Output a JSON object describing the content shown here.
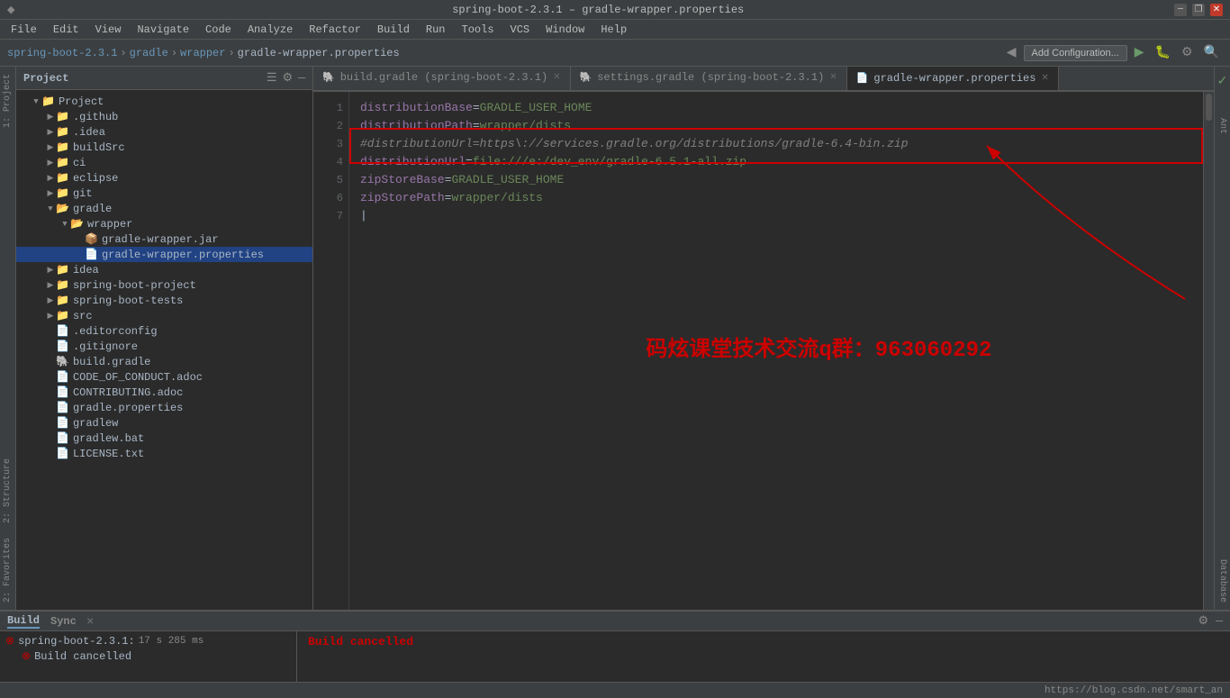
{
  "titleBar": {
    "title": "spring-boot-2.3.1 – gradle-wrapper.properties",
    "logo": "◆",
    "minimize": "—",
    "restore": "❐",
    "close": "✕"
  },
  "menuBar": {
    "items": [
      "File",
      "Edit",
      "View",
      "Navigate",
      "Code",
      "Analyze",
      "Refactor",
      "Build",
      "Run",
      "Tools",
      "VCS",
      "Window",
      "Help"
    ]
  },
  "toolbar": {
    "breadcrumbs": [
      "spring-boot-2.3.1",
      "gradle",
      "wrapper",
      "gradle-wrapper.properties"
    ],
    "addConfigLabel": "Add Configuration...",
    "icons": [
      "▶",
      "▶▶",
      "⏹",
      "🔨",
      "⚙"
    ]
  },
  "projectPanel": {
    "title": "Project",
    "items": [
      {
        "label": "Project",
        "type": "root",
        "depth": 0,
        "open": true
      },
      {
        "label": ".github",
        "type": "folder",
        "depth": 1,
        "open": false
      },
      {
        "label": ".idea",
        "type": "folder",
        "depth": 1,
        "open": false
      },
      {
        "label": "buildSrc",
        "type": "folder",
        "depth": 1,
        "open": false
      },
      {
        "label": "ci",
        "type": "folder",
        "depth": 1,
        "open": false
      },
      {
        "label": "eclipse",
        "type": "folder",
        "depth": 1,
        "open": false
      },
      {
        "label": "git",
        "type": "folder",
        "depth": 1,
        "open": false
      },
      {
        "label": "gradle",
        "type": "folder",
        "depth": 1,
        "open": true
      },
      {
        "label": "wrapper",
        "type": "folder",
        "depth": 2,
        "open": true
      },
      {
        "label": "gradle-wrapper.jar",
        "type": "jar",
        "depth": 3,
        "open": false
      },
      {
        "label": "gradle-wrapper.properties",
        "type": "properties",
        "depth": 3,
        "open": false,
        "selected": true
      },
      {
        "label": "idea",
        "type": "folder",
        "depth": 1,
        "open": false
      },
      {
        "label": "spring-boot-project",
        "type": "folder",
        "depth": 1,
        "open": false
      },
      {
        "label": "spring-boot-tests",
        "type": "folder",
        "depth": 1,
        "open": false
      },
      {
        "label": "src",
        "type": "folder",
        "depth": 1,
        "open": false
      },
      {
        "label": ".editorconfig",
        "type": "file",
        "depth": 1,
        "open": false
      },
      {
        "label": ".gitignore",
        "type": "file",
        "depth": 1,
        "open": false
      },
      {
        "label": "build.gradle",
        "type": "gradle",
        "depth": 1,
        "open": false
      },
      {
        "label": "CODE_OF_CONDUCT.adoc",
        "type": "file",
        "depth": 1,
        "open": false
      },
      {
        "label": "CONTRIBUTING.adoc",
        "type": "file",
        "depth": 1,
        "open": false
      },
      {
        "label": "gradle.properties",
        "type": "properties",
        "depth": 1,
        "open": false
      },
      {
        "label": "gradlew",
        "type": "file",
        "depth": 1,
        "open": false
      },
      {
        "label": "gradlew.bat",
        "type": "file",
        "depth": 1,
        "open": false
      },
      {
        "label": "LICENSE.txt",
        "type": "txt",
        "depth": 1,
        "open": false
      }
    ]
  },
  "tabs": [
    {
      "label": "build.gradle (spring-boot-2.3.1)",
      "active": false,
      "modified": false
    },
    {
      "label": "settings.gradle (spring-boot-2.3.1)",
      "active": false,
      "modified": false
    },
    {
      "label": "gradle-wrapper.properties",
      "active": true,
      "modified": false
    }
  ],
  "codeLines": [
    {
      "num": 1,
      "text": "distributionBase=GRADLE_USER_HOME",
      "type": "normal"
    },
    {
      "num": 2,
      "text": "distributionPath=wrapper/dists",
      "type": "normal"
    },
    {
      "num": 3,
      "text": "#distributionUrl=https\\://services.gradle.org/distributions/gradle-6.4-bin.zip",
      "type": "comment"
    },
    {
      "num": 4,
      "text": "distributionUrl=file:///e:/dev_env/gradle-6.5.1-all.zip",
      "type": "normal"
    },
    {
      "num": 5,
      "text": "zipStoreBase=GRADLE_USER_HOME",
      "type": "normal"
    },
    {
      "num": 6,
      "text": "zipStorePath=wrapper/dists",
      "type": "normal"
    },
    {
      "num": 7,
      "text": "",
      "type": "cursor"
    }
  ],
  "watermark": {
    "text": "码炫课堂技术交流q群：963060292"
  },
  "bottomPanel": {
    "buildLabel": "Build",
    "syncLabel": "Sync",
    "buildItems": [
      {
        "label": "spring-boot-2.3.1",
        "meta": "17 s 285 ms",
        "type": "error"
      },
      {
        "label": "Build cancelled",
        "meta": "",
        "type": "error"
      }
    ],
    "outputText": "Build cancelled"
  },
  "statusBar": {
    "text": "https://blog.csdn.net/smart_an"
  },
  "rightSidebar": {
    "labels": [
      "Ant",
      "Database",
      "Structure"
    ]
  }
}
